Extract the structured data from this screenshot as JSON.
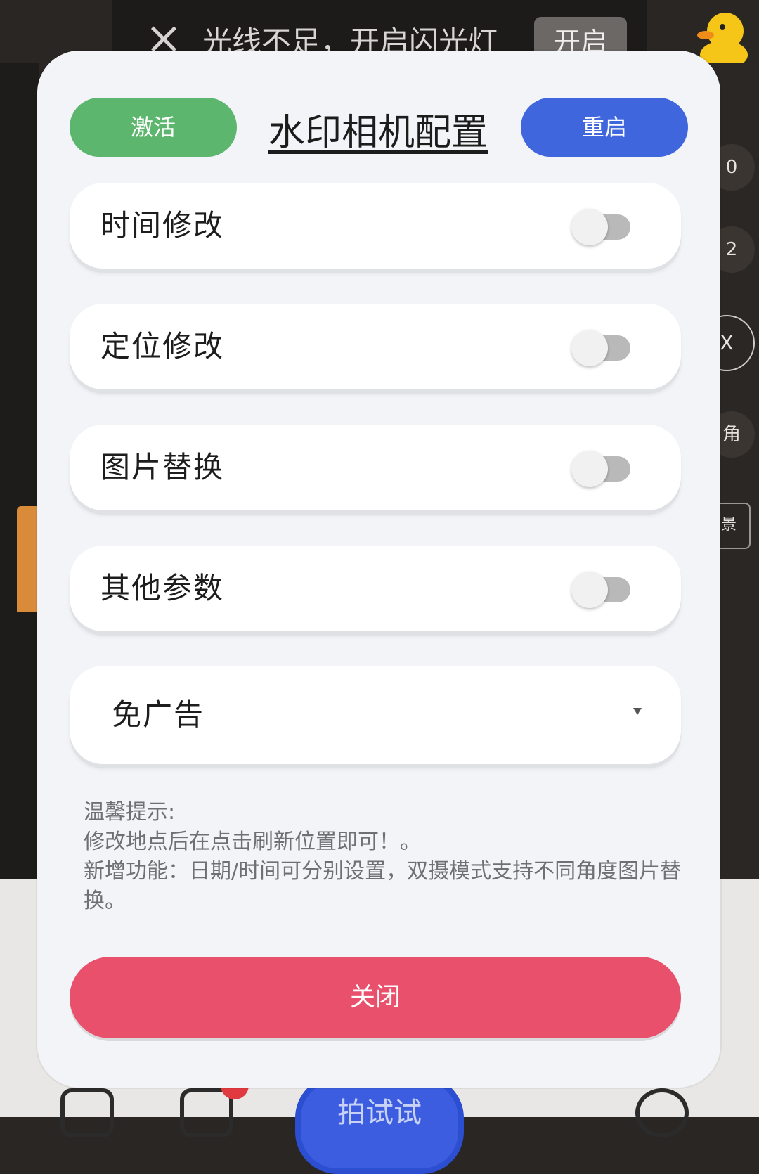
{
  "background": {
    "flash_banner": {
      "text": "光线不足，开启闪光灯",
      "button": "开启"
    },
    "right_controls": [
      "0",
      "2",
      "X",
      "角",
      "景"
    ],
    "shutter_label": "拍试试"
  },
  "modal": {
    "title": "水印相机配置",
    "activate_label": "激活",
    "restart_label": "重启",
    "options": [
      {
        "label": "时间修改",
        "enabled": false
      },
      {
        "label": "定位修改",
        "enabled": false
      },
      {
        "label": "图片替换",
        "enabled": false
      },
      {
        "label": "其他参数",
        "enabled": false
      }
    ],
    "dropdown": {
      "selected": "免广告"
    },
    "tips": {
      "heading": "温馨提示:",
      "line1": "修改地点后在点击刷新位置即可！。",
      "line2": "新增功能：日期/时间可分别设置，双摄模式支持不同角度图片替换。"
    },
    "close_label": "关闭"
  },
  "colors": {
    "activate": "#5cb66e",
    "restart": "#3f66dc",
    "close": "#e9506c",
    "modal_bg": "#f3f4f7"
  }
}
